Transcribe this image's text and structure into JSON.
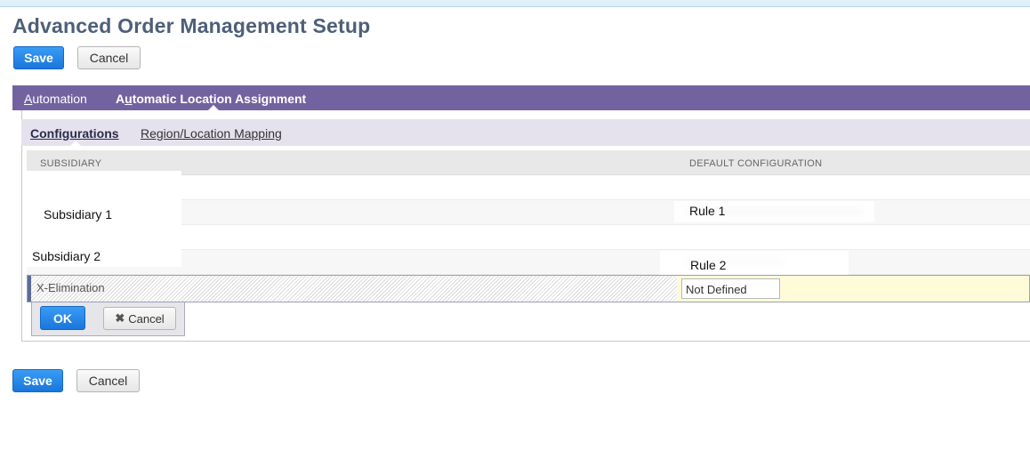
{
  "page": {
    "title": "Advanced Order Management Setup"
  },
  "toolbar_top": {
    "save_label": "Save",
    "cancel_label": "Cancel"
  },
  "toolbar_bottom": {
    "save_label": "Save",
    "cancel_label": "Cancel"
  },
  "main_tabs": [
    {
      "label": "Automation",
      "accel": "A",
      "rest": "utomation",
      "active": false
    },
    {
      "label": "Automatic Location Assignment",
      "pre": "A",
      "accel": "u",
      "rest": "tomatic Location Assignment",
      "active": true
    }
  ],
  "sub_tabs": [
    {
      "label": "Configurations",
      "active": true
    },
    {
      "label": "Region/Location Mapping",
      "active": false
    }
  ],
  "table": {
    "columns": [
      "SUBSIDIARY",
      "DEFAULT CONFIGURATION"
    ],
    "rows": [
      {
        "subsidiary": "Subsidiary 1",
        "default_configuration": "Rule 1"
      },
      {
        "subsidiary": "Subsidiary 2",
        "default_configuration": "Rule 2"
      }
    ],
    "edit_row": {
      "subsidiary": "X-Elimination",
      "default_configuration": "Not Defined"
    }
  },
  "edit_actions": {
    "ok_label": "OK",
    "cancel_label": "Cancel"
  },
  "icons": {
    "cancel": "close-icon"
  },
  "colors": {
    "tab_bar": "#7263a0",
    "sub_tab_bar": "#e5e2ee",
    "primary_button": "#1a76db",
    "edit_highlight": "#fffbd9"
  }
}
